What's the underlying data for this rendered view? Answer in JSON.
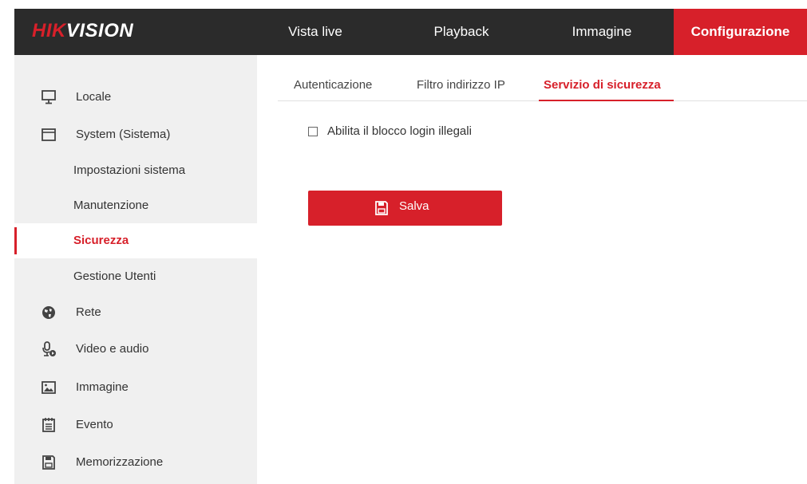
{
  "logo": {
    "hik": "HIK",
    "vision": "VISION"
  },
  "topnav": {
    "live": "Vista live",
    "playback": "Playback",
    "image": "Immagine",
    "config": "Configurazione"
  },
  "sidebar": {
    "items": [
      {
        "label": "Locale",
        "icon": "monitor-icon"
      },
      {
        "label": "System (Sistema)",
        "icon": "system-window-icon"
      },
      {
        "label": "Impostazioni sistema"
      },
      {
        "label": "Manutenzione"
      },
      {
        "label": "Sicurezza"
      },
      {
        "label": "Gestione Utenti"
      },
      {
        "label": "Rete",
        "icon": "globe-icon"
      },
      {
        "label": "Video e audio",
        "icon": "microphone-icon"
      },
      {
        "label": "Immagine",
        "icon": "image-icon"
      },
      {
        "label": "Evento",
        "icon": "calendar-icon"
      },
      {
        "label": "Memorizzazione",
        "icon": "storage-icon"
      }
    ]
  },
  "tabs": {
    "auth": "Autenticazione",
    "ipfilter": "Filtro indirizzo IP",
    "security": "Servizio di sicurezza"
  },
  "form": {
    "illegal_login_label": "Abilita il blocco login illegali",
    "illegal_login_checked": false
  },
  "actions": {
    "save_label": "Salva"
  },
  "colors": {
    "accent": "#d7202a",
    "topbar": "#2b2b2b",
    "sidebar": "#f0f0f0"
  }
}
